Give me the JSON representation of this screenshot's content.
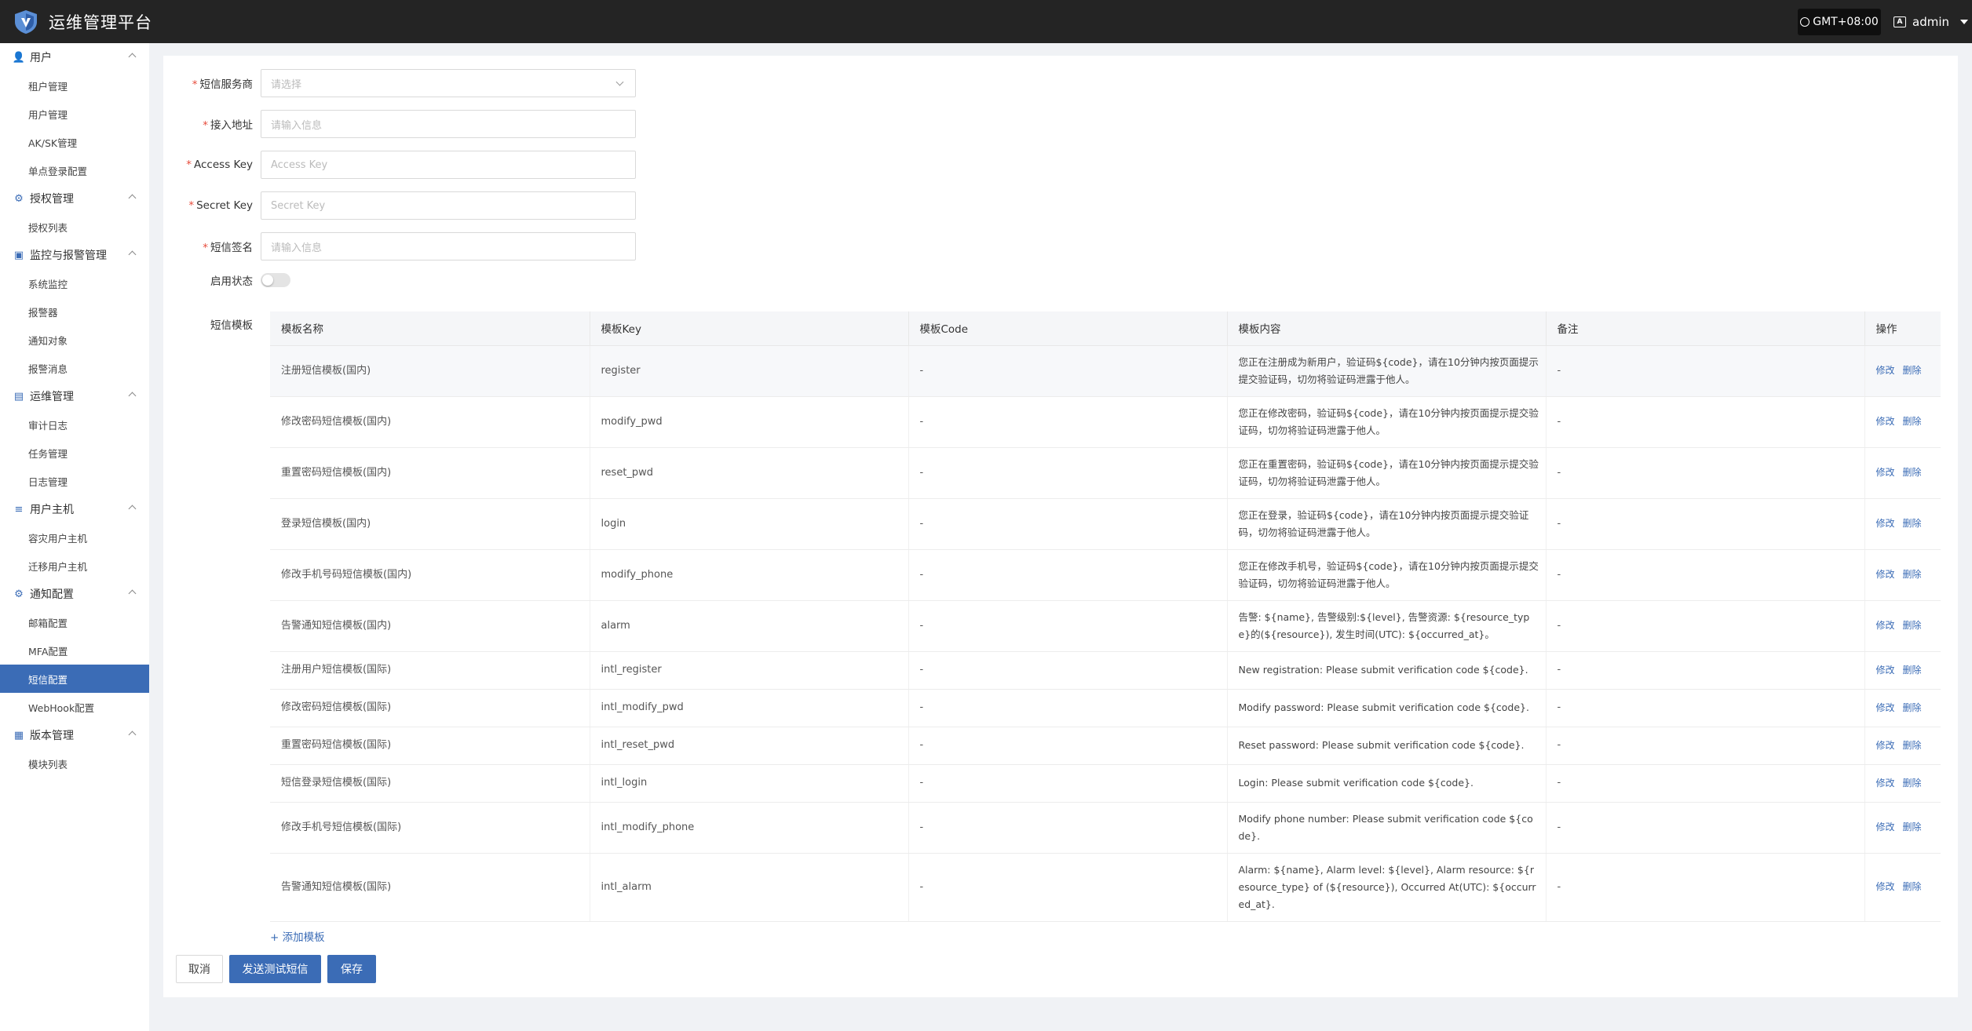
{
  "app": {
    "title": "运维管理平台",
    "timezone": "GMT+08:00",
    "user": "admin",
    "accent_color": "#3b6cb6"
  },
  "sidebar": {
    "groups": [
      {
        "label": "用户",
        "icon": "user-icon",
        "items": [
          "租户管理",
          "用户管理",
          "AK/SK管理",
          "单点登录配置"
        ]
      },
      {
        "label": "授权管理",
        "icon": "authorization-icon",
        "items": [
          "授权列表"
        ]
      },
      {
        "label": "监控与报警管理",
        "icon": "monitor-icon",
        "items": [
          "系统监控",
          "报警器",
          "通知对象",
          "报警消息"
        ]
      },
      {
        "label": "运维管理",
        "icon": "ops-icon",
        "items": [
          "审计日志",
          "任务管理",
          "日志管理"
        ]
      },
      {
        "label": "用户主机",
        "icon": "host-icon",
        "items": [
          "容灾用户主机",
          "迁移用户主机"
        ]
      },
      {
        "label": "通知配置",
        "icon": "gear-icon",
        "items": [
          "邮箱配置",
          "MFA配置",
          "短信配置",
          "WebHook配置"
        ]
      },
      {
        "label": "版本管理",
        "icon": "version-icon",
        "items": [
          "模块列表"
        ]
      }
    ],
    "active_item": "短信配置"
  },
  "form": {
    "provider": {
      "label": "短信服务商",
      "placeholder": "请选择"
    },
    "endpoint": {
      "label": "接入地址",
      "placeholder": "请输入信息"
    },
    "access_key": {
      "label": "Access Key",
      "placeholder": "Access Key"
    },
    "secret_key": {
      "label": "Secret Key",
      "placeholder": "Secret Key"
    },
    "signature": {
      "label": "短信签名",
      "placeholder": "请输入信息"
    },
    "enabled": {
      "label": "启用状态",
      "value": false
    },
    "templates_label": "短信模板"
  },
  "table": {
    "headers": [
      "模板名称",
      "模板Key",
      "模板Code",
      "模板内容",
      "备注",
      "操作"
    ],
    "edit_label": "修改",
    "delete_label": "删除",
    "rows": [
      {
        "name": "注册短信模板(国内)",
        "key": "register",
        "code": "-",
        "content": "您正在注册成为新用户，验证码${code}，请在10分钟内按页面提示提交验证码，切勿将验证码泄露于他人。",
        "remark": "-"
      },
      {
        "name": "修改密码短信模板(国内)",
        "key": "modify_pwd",
        "code": "-",
        "content": "您正在修改密码，验证码${code}，请在10分钟内按页面提示提交验证码，切勿将验证码泄露于他人。",
        "remark": "-"
      },
      {
        "name": "重置密码短信模板(国内)",
        "key": "reset_pwd",
        "code": "-",
        "content": "您正在重置密码，验证码${code}，请在10分钟内按页面提示提交验证码，切勿将验证码泄露于他人。",
        "remark": "-"
      },
      {
        "name": "登录短信模板(国内)",
        "key": "login",
        "code": "-",
        "content": "您正在登录，验证码${code}，请在10分钟内按页面提示提交验证码，切勿将验证码泄露于他人。",
        "remark": "-"
      },
      {
        "name": "修改手机号码短信模板(国内)",
        "key": "modify_phone",
        "code": "-",
        "content": "您正在修改手机号，验证码${code}，请在10分钟内按页面提示提交验证码，切勿将验证码泄露于他人。",
        "remark": "-"
      },
      {
        "name": "告警通知短信模板(国内)",
        "key": "alarm",
        "code": "-",
        "content": "告警: ${name}, 告警级别:${level}, 告警资源: ${resource_type}的(${resource}), 发生时间(UTC): ${occurred_at}。",
        "remark": "-"
      },
      {
        "name": "注册用户短信模板(国际)",
        "key": "intl_register",
        "code": "-",
        "content": "New registration: Please submit verification code ${code}.",
        "remark": "-"
      },
      {
        "name": "修改密码短信模板(国际)",
        "key": "intl_modify_pwd",
        "code": "-",
        "content": "Modify password: Please submit verification code ${code}.",
        "remark": "-"
      },
      {
        "name": "重置密码短信模板(国际)",
        "key": "intl_reset_pwd",
        "code": "-",
        "content": "Reset password: Please submit verification code ${code}.",
        "remark": "-"
      },
      {
        "name": "短信登录短信模板(国际)",
        "key": "intl_login",
        "code": "-",
        "content": "Login: Please submit verification code ${code}.",
        "remark": "-"
      },
      {
        "name": "修改手机号短信模板(国际)",
        "key": "intl_modify_phone",
        "code": "-",
        "content": "Modify phone number: Please submit verification code ${code}.",
        "remark": "-"
      },
      {
        "name": "告警通知短信模板(国际)",
        "key": "intl_alarm",
        "code": "-",
        "content": "Alarm: ${name}, Alarm level: ${level}, Alarm resource: ${resource_type} of (${resource}), Occurred At(UTC): ${occurred_at}.",
        "remark": "-"
      }
    ]
  },
  "actions": {
    "add_template": "+ 添加模板",
    "cancel": "取消",
    "send_test": "发送测试短信",
    "save": "保存"
  }
}
